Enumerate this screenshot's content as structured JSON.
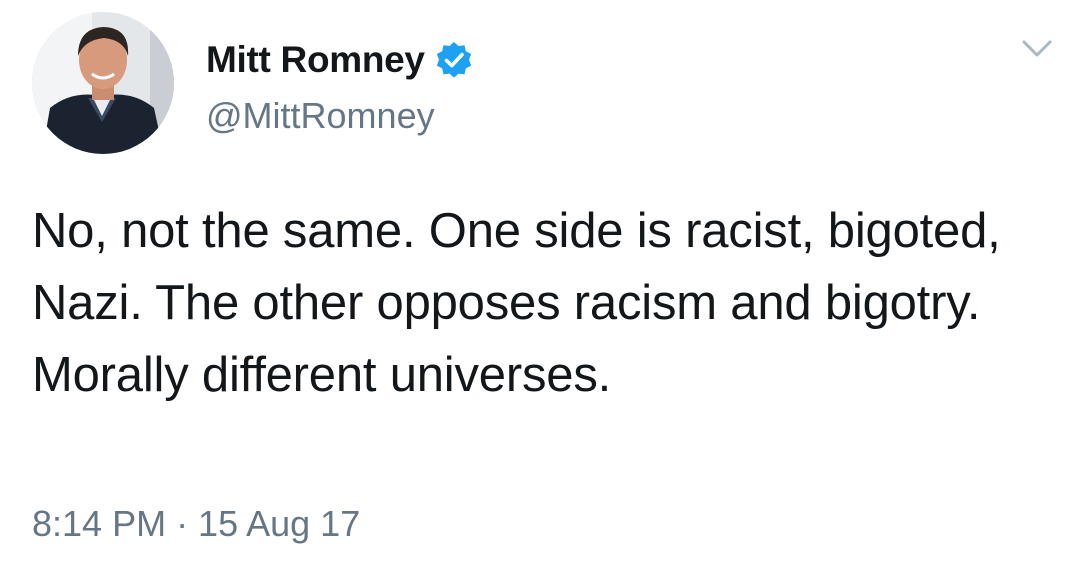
{
  "tweet": {
    "author": {
      "display_name": "Mitt Romney",
      "handle": "@MittRomney",
      "verified": true
    },
    "text": "No, not the same. One side is racist, bigoted, Nazi. The other opposes racism and bigotry. Morally different universes.",
    "timestamp": "8:14 PM · 15 Aug 17"
  },
  "icons": {
    "verified": "verified-badge-icon",
    "menu": "chevron-down-icon"
  },
  "colors": {
    "text": "#14171a",
    "secondary_text": "#657786",
    "verified_blue": "#1da1f2",
    "caret": "#aab8c2",
    "background": "#ffffff"
  }
}
